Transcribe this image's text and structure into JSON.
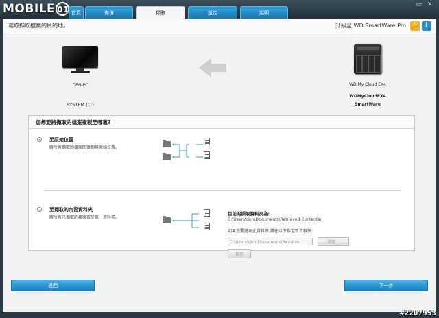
{
  "titlebar": {
    "logo": "MOBILE",
    "logo_badge": "01",
    "tabs": [
      {
        "label": "首頁",
        "active": false
      },
      {
        "label": "備份",
        "active": false
      },
      {
        "label": "擷取",
        "active": true
      },
      {
        "label": "設定",
        "active": false
      },
      {
        "label": "說明",
        "active": false
      }
    ],
    "window_buttons": [
      "▭",
      "✕"
    ]
  },
  "header": {
    "instruction": "選取擷取檔案的目的地。",
    "upgrade_text": "升級至 WD SmartWare Pro",
    "key_icon": "🔑",
    "info_icon": "i"
  },
  "devices": {
    "source": {
      "name": "DEN-PC",
      "drive": "SYSTEM (C:)"
    },
    "arrow": "←",
    "target": {
      "model": "WD My Cloud EX4",
      "name": "WDMyCloudEX4",
      "subtitle": "SmartWare"
    }
  },
  "options": {
    "question": "您想要將擷取的檔案複製至哪裏?",
    "original": {
      "title": "至原始位置",
      "description": "將所有擷取的檔案回復到其原始位置。",
      "selected": true
    },
    "retrieved": {
      "title": "至擷取的內容資料夾",
      "description": "將所有已擷取的檔案置於單一資料夾。",
      "selected": false,
      "current_folder_label": "目前的擷取資料夾為:",
      "current_folder_path": "C:\\Users\\den\\Documents\\Retrieved Contents\\",
      "change_hint": "如果您要變更此資料夾,請在以下指定新資料夾:",
      "path_input_value": "C:\\Users\\den\\Documents\\Retrieve",
      "browse_label": "瀏覽...",
      "apply_label": "套用"
    }
  },
  "footer": {
    "back_label": "返回",
    "next_label": "下一步"
  },
  "watermark": "#2207953",
  "colors": {
    "accent": "#1f8fcc",
    "titlebar": "#2b3a44",
    "panel": "#f1f2f2"
  }
}
